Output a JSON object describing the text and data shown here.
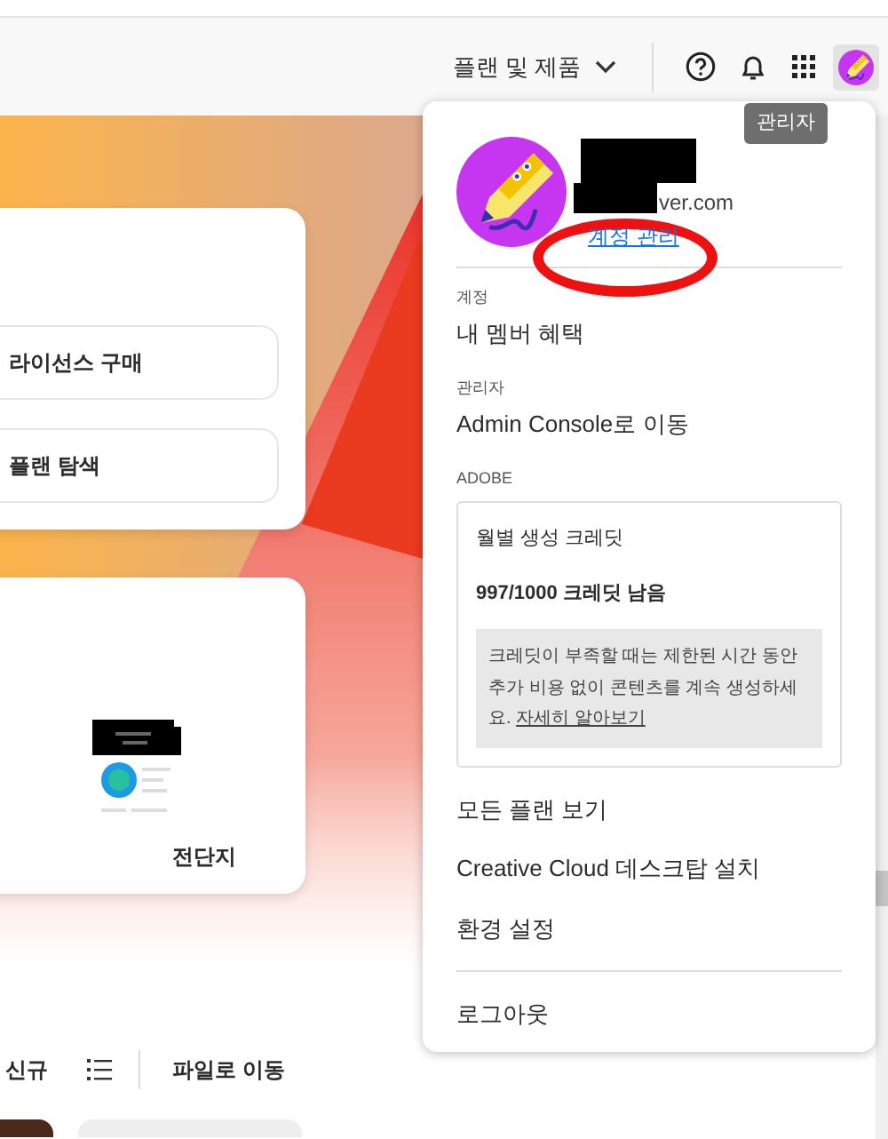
{
  "header": {
    "plans_menu": "플랜 및 제품",
    "avatar_tooltip": "관리자"
  },
  "left": {
    "actions": [
      "라이선스 구매",
      "플랜 탐색"
    ],
    "template_label": "전단지",
    "toolbar": {
      "new": "신규",
      "goto": "파일로 이동"
    }
  },
  "menu": {
    "email": "ver.com",
    "manage_link": "계정 관리",
    "sections": [
      {
        "heading": "계정",
        "items": [
          "내 멤버 혜택"
        ]
      },
      {
        "heading": "관리자",
        "items": [
          "Admin Console로 이동"
        ]
      },
      {
        "heading": "ADOBE"
      }
    ],
    "credits": {
      "title": "월별 생성 크레딧",
      "remaining": "997/1000 크레딧 남음",
      "note": "크레딧이 부족할 때는 제한된 시간 동안 추가 비용 없이 콘텐츠를 계속 생성하세요. ",
      "link": "자세히 알아보기"
    },
    "links": [
      "모든 플랜 보기",
      "Creative Cloud 데스크탑 설치",
      "환경 설정"
    ],
    "logout": "로그아웃"
  }
}
